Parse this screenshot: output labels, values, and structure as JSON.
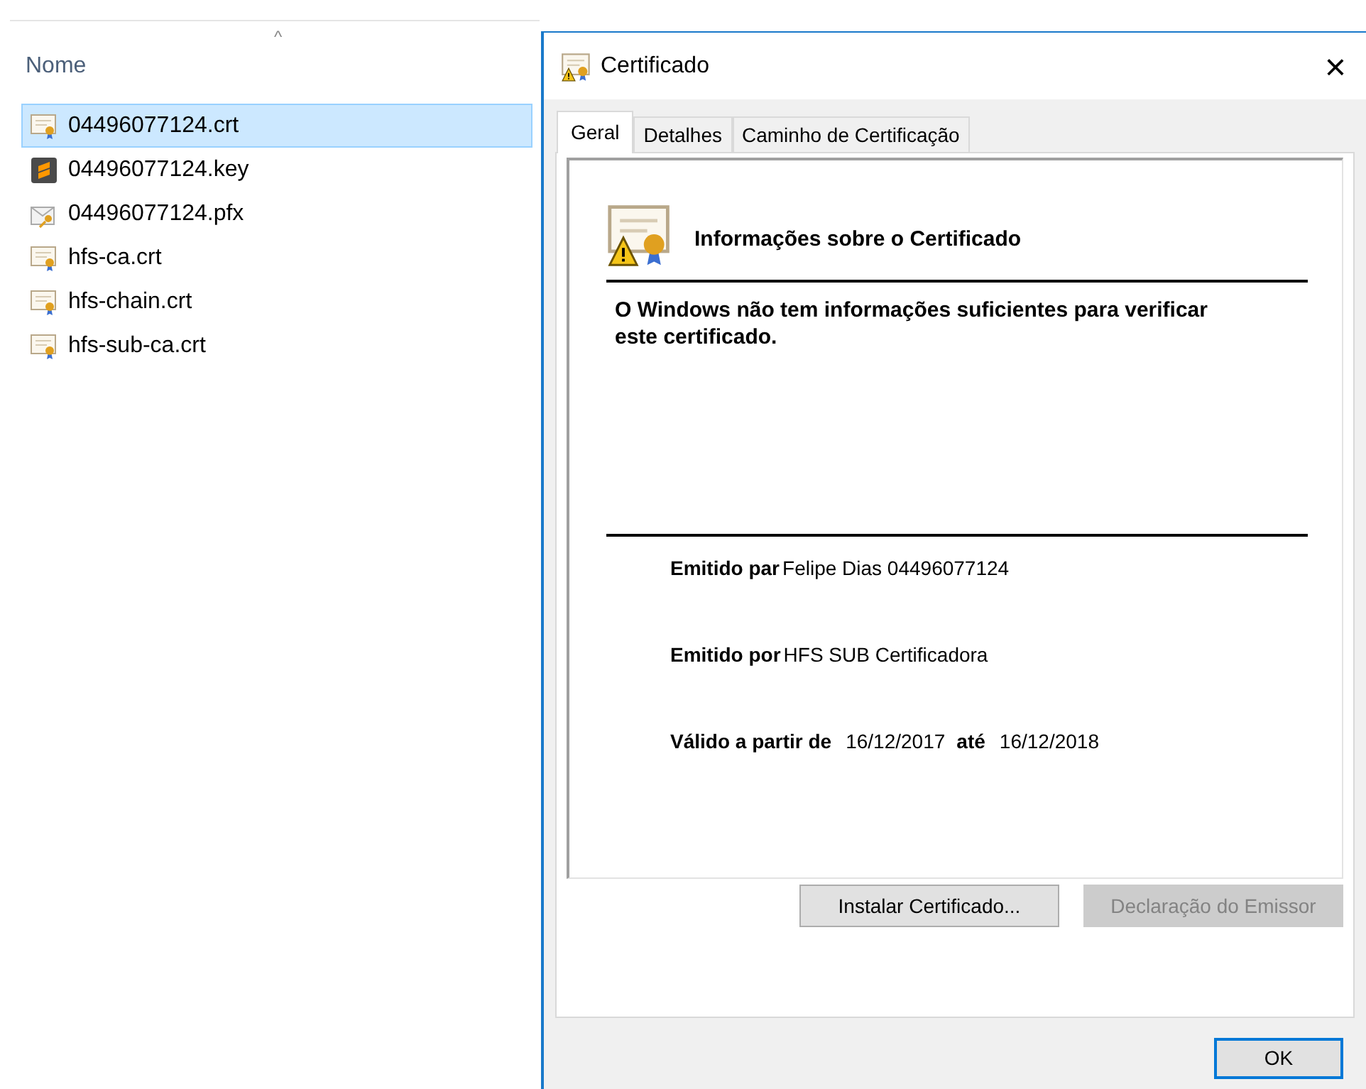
{
  "explorer": {
    "column_header": "Nome",
    "sort_caret": "^",
    "files": [
      {
        "name": "04496077124.crt",
        "kind": "cert",
        "selected": true
      },
      {
        "name": "04496077124.key",
        "kind": "sublime",
        "selected": false
      },
      {
        "name": "04496077124.pfx",
        "kind": "pfx",
        "selected": false
      },
      {
        "name": "hfs-ca.crt",
        "kind": "cert",
        "selected": false
      },
      {
        "name": "hfs-chain.crt",
        "kind": "cert",
        "selected": false
      },
      {
        "name": "hfs-sub-ca.crt",
        "kind": "cert",
        "selected": false
      }
    ]
  },
  "dialog": {
    "title": "Certificado",
    "close": "×",
    "tabs": [
      {
        "label": "Geral",
        "selected": true
      },
      {
        "label": "Detalhes",
        "selected": false
      },
      {
        "label": "Caminho de Certificação",
        "selected": false
      }
    ],
    "heading": "Informações sobre o Certificado",
    "message": "O Windows não tem informações suficientes para verificar este certificado.",
    "issued_to": {
      "label": "Emitido par",
      "value": "Felipe Dias 04496077124"
    },
    "issued_by": {
      "label": "Emitido por",
      "value": "HFS SUB Certificadora"
    },
    "validity": {
      "label": "Válido a partir de",
      "from": "16/12/2017",
      "to_label": "até",
      "to": "16/12/2018"
    },
    "buttons": [
      {
        "label": "Instalar Certificado...",
        "disabled": false
      },
      {
        "label": "Declaração do Emissor",
        "disabled": true
      }
    ],
    "ok": "OK"
  }
}
